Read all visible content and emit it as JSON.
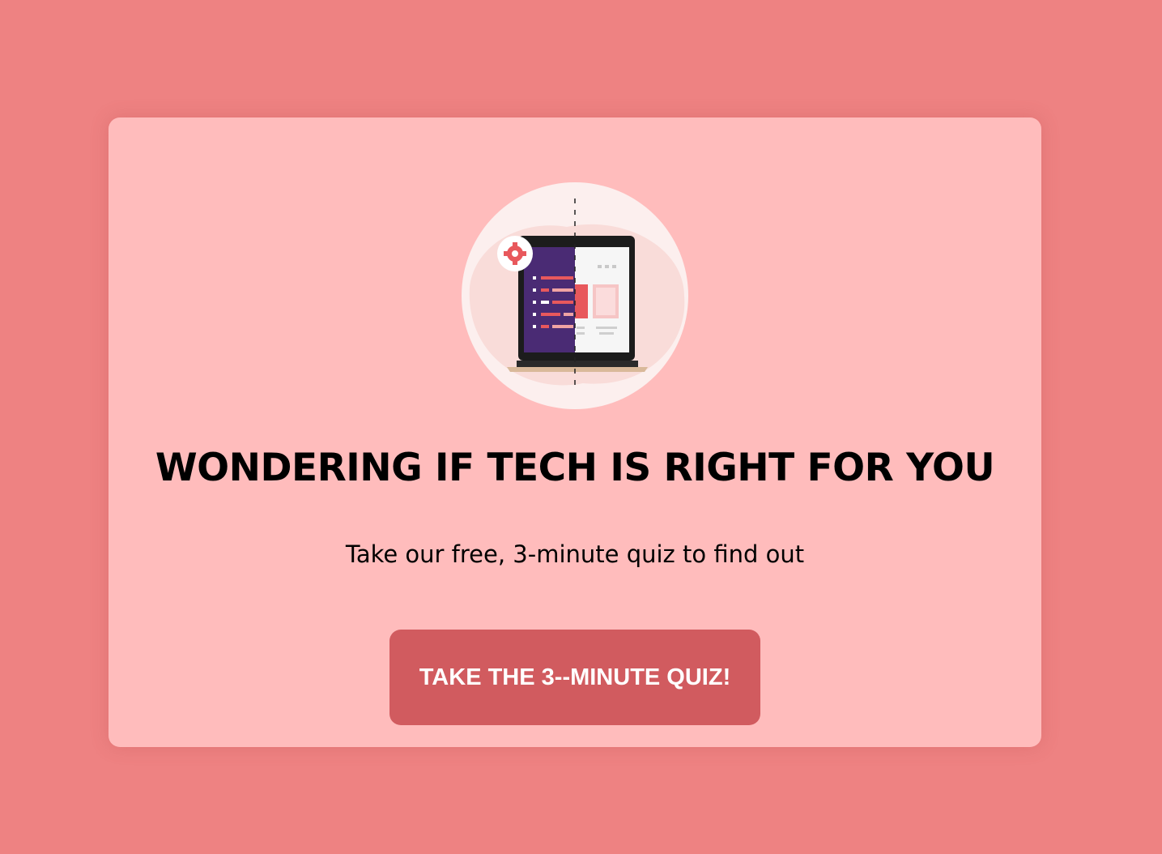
{
  "card": {
    "title": "WONDERING IF TECH IS RIGHT FOR YOU",
    "subtitle": "Take our free, 3-minute quiz to find out",
    "cta_label": "TAKE THE 3--MINUTE QUIZ!"
  },
  "hero": {
    "image": "laptop-split-screen-illustration",
    "icons": [
      "gear-icon",
      "laptop-icon"
    ]
  },
  "colors": {
    "page_background": "#ee8282",
    "card_background": "#ffbcbc",
    "button_background": "#d15b5f",
    "button_text": "#ffffff",
    "title_text": "#000000",
    "illustration_purple": "#4a2b74",
    "illustration_red": "#e8585c"
  }
}
